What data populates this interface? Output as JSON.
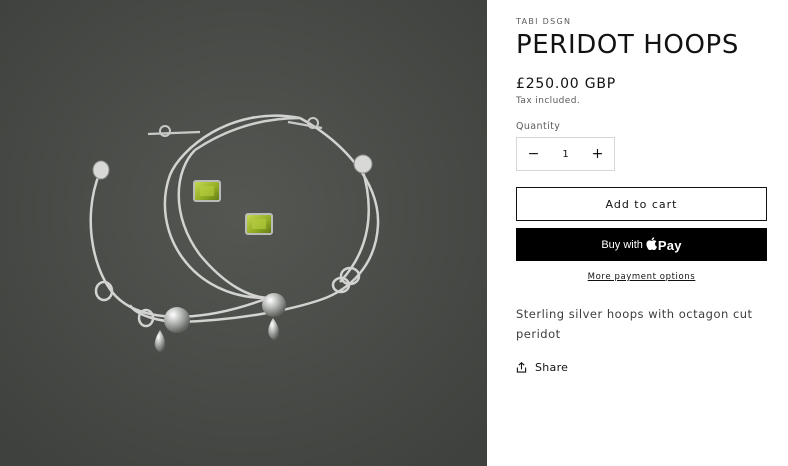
{
  "product": {
    "vendor": "TABI DSGN",
    "title": "PERIDOT HOOPS",
    "price": "£250.00 GBP",
    "tax_note": "Tax included.",
    "description": "Sterling silver hoops with octagon cut peridot",
    "image_alt": "Silver hoop earrings with peridot stones"
  },
  "quantity": {
    "label": "Quantity",
    "value": "1",
    "decrease_symbol": "−",
    "increase_symbol": "+"
  },
  "actions": {
    "add_to_cart": "Add to cart",
    "buy_with": "Buy with",
    "pay_brand": "Pay",
    "more_payment_options": "More payment options",
    "share": "Share"
  },
  "icons": {
    "apple": "apple-logo-icon",
    "share": "share-icon"
  },
  "colors": {
    "photo_background": "#4a4d49",
    "buy_button": "#000000",
    "text": "#121212",
    "peridot": "#9bb82a"
  }
}
